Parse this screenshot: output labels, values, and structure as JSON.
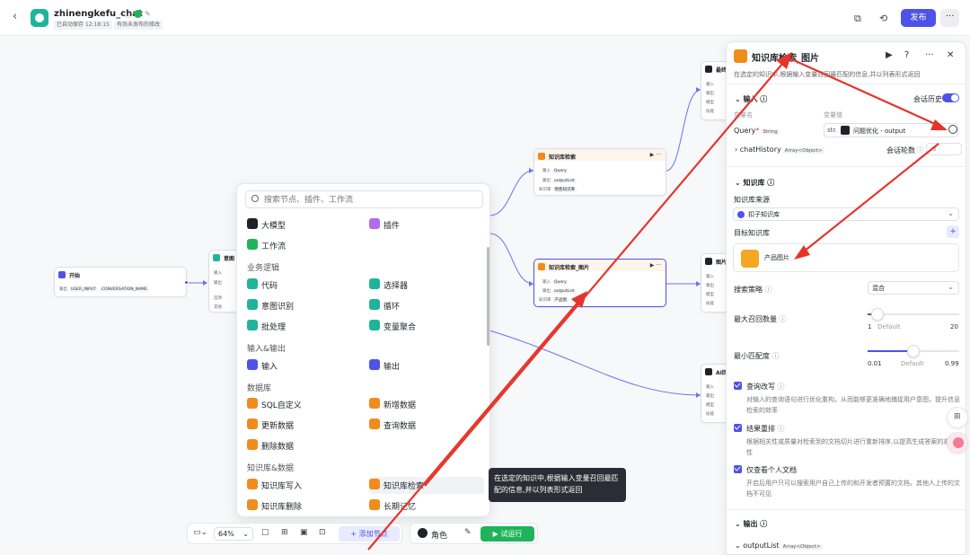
{
  "header": {
    "app_name": "zhinengkefu_chat",
    "autosave": "已自动保存 12:18:15",
    "unpublished": "有尚未发布的修改",
    "publish": "发布",
    "more": "···",
    "back": "‹"
  },
  "canvas_nodes": {
    "start": {
      "title": "开始",
      "in_label": "输出",
      "p1": "USER_INPUT",
      "p2": "CONVERSATION_NAME"
    },
    "intent": {
      "title": "意图",
      "r1": "输入",
      "r2": "输出",
      "r3": "选项",
      "r4": "其他"
    },
    "kb_top": {
      "title": "知识库检索",
      "r_in": "输入",
      "r_in_v": "Query",
      "r_out": "输出",
      "r_out_v": "outputList",
      "r_kb": "知识库",
      "r_kb_v": "销售知识库"
    },
    "kb_img": {
      "title": "知识库检索_图片",
      "r_in": "输入",
      "r_in_v": "Query",
      "r_out": "输出",
      "r_out_v": "outputList",
      "r_kb": "知识库",
      "r_kb_v": "产品图"
    },
    "right1": {
      "title": "最终",
      "rows": [
        "输入",
        "输出",
        "模型",
        "技能"
      ]
    },
    "right2": {
      "title": "图片",
      "rows": [
        "输入",
        "输出",
        "模型",
        "技能"
      ]
    },
    "right3": {
      "title": "AI回",
      "rows": [
        "输入",
        "输出",
        "模型",
        "技能"
      ]
    },
    "play": "▶",
    "dots": "···"
  },
  "menu": {
    "search_placeholder": "搜索节点、插件、工作流",
    "row1": [
      "大模型",
      "插件"
    ],
    "row2": [
      "工作流"
    ],
    "sec_logic": "业务逻辑",
    "logic": [
      "代码",
      "选择器",
      "意图识别",
      "循环",
      "批处理",
      "变量聚合"
    ],
    "sec_io": "输入&输出",
    "io": [
      "输入",
      "输出"
    ],
    "sec_db": "数据库",
    "db": [
      "SQL自定义",
      "新增数据",
      "更新数据",
      "查询数据",
      "删除数据"
    ],
    "sec_kb": "知识库&数据",
    "kb": [
      "知识库写入",
      "知识库检索",
      "知识库删除",
      "长期记忆"
    ]
  },
  "tooltip": "在选定的知识中,根据输入变量召回最匹配的信息,并以列表形式返回",
  "bottombar": {
    "zoom": "64%",
    "add_node": "+ 添加节点",
    "role": "角色",
    "run": "▶ 试运行"
  },
  "panel": {
    "title": "知识库检索_图片",
    "description": "在选定的知识中,根据输入变量召回最匹配的信息,并以列表形式返回",
    "input_section": "输入",
    "chat_history": "会话历史",
    "col_var": "变量名",
    "col_val": "变量值",
    "query_name": "Query",
    "required": "*",
    "query_type": "String",
    "ref_prefix": "str.",
    "ref_value": "问题优化 - output",
    "chathistory_name": "chatHistory",
    "chathistory_type": "Array<Object>",
    "rounds_label": "会话轮数",
    "rounds_value": "3",
    "kb_section": "知识库",
    "kb_source_label": "知识库来源",
    "kb_source_value": "扣子知识库",
    "target_kb_label": "目标知识库",
    "target_kb_name": "产品图片",
    "strategy_label": "搜索策略",
    "strategy_value": "混合",
    "max_recall_label": "最大召回数量",
    "max_recall_min": "1",
    "max_recall_default_label": "Default",
    "max_recall_max": "20",
    "max_recall_value": 3,
    "min_match_label": "最小匹配度",
    "min_match_min": "0.01",
    "min_match_default_label": "Default",
    "min_match_max": "0.99",
    "min_match_value": 0.5,
    "rewrite_label": "查询改写",
    "rewrite_desc": "对输入的查询语句进行优化重构，从而能够更准确地捕捉用户意图，提升信息检索的效率",
    "rerank_label": "结果重排",
    "rerank_desc": "根据相关性或质量对检索到的文档切片进行重新排序,以提高生成答案的准确性",
    "personal_label": "仅查看个人文档",
    "personal_desc": "开启后用户只可以搜索用户自己上传的和开发者预置的文档，其他人上传的文档不可见",
    "output_section": "输出",
    "output_name": "outputList",
    "output_type": "Array<Object>"
  },
  "colors": {
    "accent": "#4d53e8",
    "run": "#1fb45a",
    "kb_node": "#f08c1c",
    "arrow": "#e5352b"
  }
}
